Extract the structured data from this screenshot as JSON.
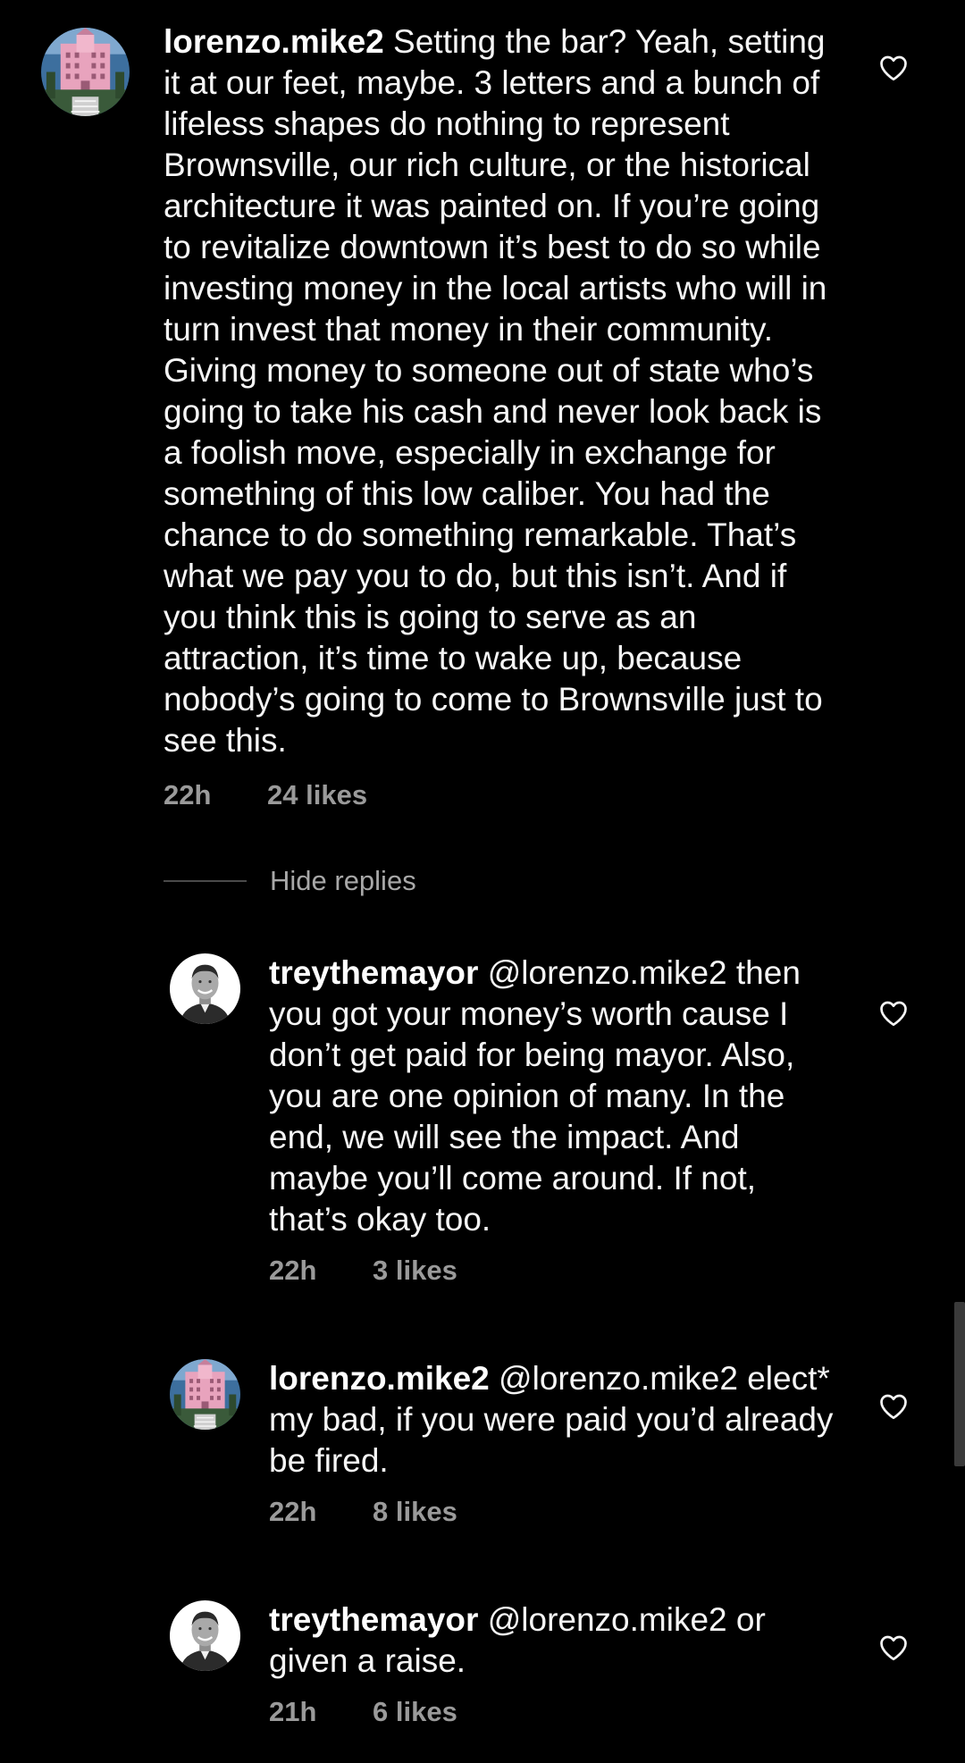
{
  "comments": [
    {
      "username": "lorenzo.mike2",
      "text": "Setting the bar? Yeah, setting it at our feet, maybe. 3 letters and a bunch of lifeless shapes do nothing to represent Brownsville, our rich culture, or the historical architecture it was painted on. If you’re going to revitalize downtown it’s best to do so while investing money in the local artists who will in turn invest that money in their community. Giving money to someone out of state who’s going to take his cash and never look back is a foolish move, especially in exchange for something of this low caliber. You had the chance to do something remarkable. That’s what we pay you to do, but this isn’t. And if you think this is going to serve as an attraction, it’s time to wake up, because nobody’s going to come to Brownsville just to see this.",
      "time": "22h",
      "likes": "24 likes",
      "avatar_icon": "pink-building-avatar",
      "like_icon": "heart-outline-icon"
    }
  ],
  "hide_replies_label": "Hide replies",
  "replies": [
    {
      "username": "treythemayor",
      "text": "@lorenzo.mike2 then you got your money’s worth cause I don’t get paid for being mayor.  Also, you are one opinion of many. In the end, we will see the impact.  And maybe you’ll come around. If not, that’s okay too.",
      "time": "22h",
      "likes": "3 likes",
      "avatar_icon": "man-portrait-avatar",
      "like_icon": "heart-outline-icon"
    },
    {
      "username": "lorenzo.mike2",
      "text": "@lorenzo.mike2 elect* my bad, if you were paid you’d already be fired.",
      "time": "22h",
      "likes": "8 likes",
      "avatar_icon": "pink-building-avatar",
      "like_icon": "heart-outline-icon"
    },
    {
      "username": "treythemayor",
      "text": "@lorenzo.mike2 or given a raise.",
      "time": "21h",
      "likes": "6 likes",
      "avatar_icon": "man-portrait-avatar",
      "like_icon": "heart-outline-icon"
    }
  ],
  "colors": {
    "background": "#000000",
    "text": "#f5f5f5",
    "meta": "#9a9a9a"
  }
}
